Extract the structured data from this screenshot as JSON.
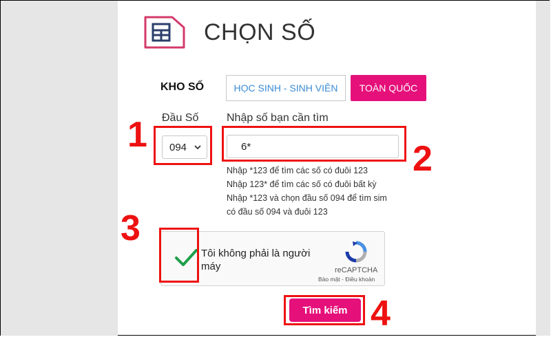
{
  "page": {
    "title": "CHỌN SỐ"
  },
  "kho_so": {
    "label": "KHO SỐ",
    "tabs": [
      {
        "label": "HỌC SINH - SINH VIÊN",
        "active": false
      },
      {
        "label": "TOÀN QUỐC",
        "active": true
      }
    ]
  },
  "dau_so": {
    "label": "Đầu Số",
    "selected": "094"
  },
  "search": {
    "label": "Nhập số bạn cần tìm",
    "value": "6*",
    "hints": [
      "Nhập *123 để tìm các số có đuôi 123",
      "Nhập 123* để tìm các số có đuôi bất kỳ",
      "Nhập *123 và chọn đầu số 094 để tìm sim",
      "có đầu số 094 và đuôi 123"
    ]
  },
  "captcha": {
    "label": "Tôi không phải là người máy",
    "brand": "reCAPTCHA",
    "terms": "Bảo mật - Điều khoản",
    "checked": true
  },
  "submit": {
    "label": "Tìm kiếm"
  },
  "annotations": {
    "step1": "1",
    "step2": "2",
    "step3": "3",
    "step4": "4"
  },
  "colors": {
    "accent": "#e5107a",
    "link": "#3a8bd6",
    "annotation": "#ee1111",
    "check": "#1e9e4a"
  }
}
